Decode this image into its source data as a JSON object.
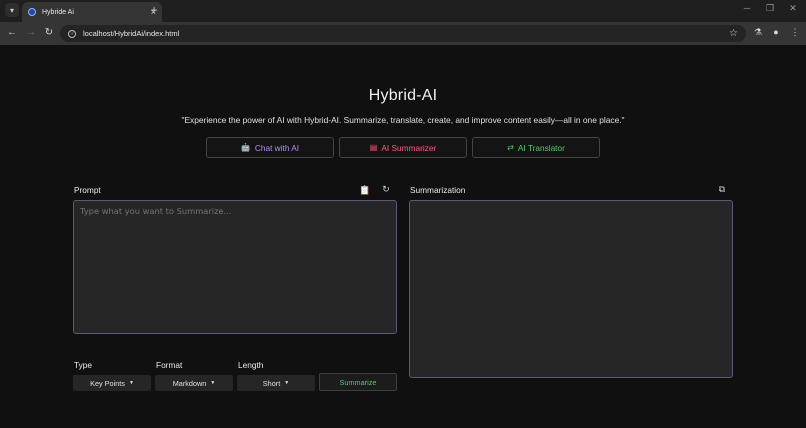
{
  "browser": {
    "tab_title": "Hybride Ai",
    "tab_close": "×",
    "new_tab": "+",
    "url": "localhost/HybridAi/index.html",
    "tab_search_icon": "▾",
    "minimize": "─",
    "restore": "❐",
    "close": "✕",
    "back": "←",
    "forward": "→",
    "reload": "↻",
    "star": "☆",
    "labs_icon": "⚗",
    "profile_icon": "●",
    "menu_icon": "⋮"
  },
  "header": {
    "title": "Hybrid-AI",
    "tagline": "\"Experience the power of AI with Hybrid-AI. Summarize, translate, create, and improve content easily—all in one place.\""
  },
  "nav": {
    "items": [
      {
        "label": "Chat with AI",
        "icon": "robot-icon",
        "glyph": "🤖",
        "color": "#b388ff"
      },
      {
        "label": "AI Summarizer",
        "icon": "document-icon",
        "glyph": "▤",
        "color": "#ff5c7a"
      },
      {
        "label": "AI Translator",
        "icon": "translate-icon",
        "glyph": "⇄",
        "color": "#4ccf6a"
      }
    ]
  },
  "prompt": {
    "label": "Prompt",
    "placeholder": "Type what you want to Summarize...",
    "paste_icon": "📋",
    "reset_icon": "↻"
  },
  "output": {
    "label": "Summarization",
    "copy_icon": "⧉",
    "value": ""
  },
  "options": {
    "type_label": "Type",
    "type_value": "Key Points",
    "format_label": "Format",
    "format_value": "Markdown",
    "length_label": "Length",
    "length_value": "Short",
    "caret": "▼",
    "submit_label": "Summarize"
  }
}
